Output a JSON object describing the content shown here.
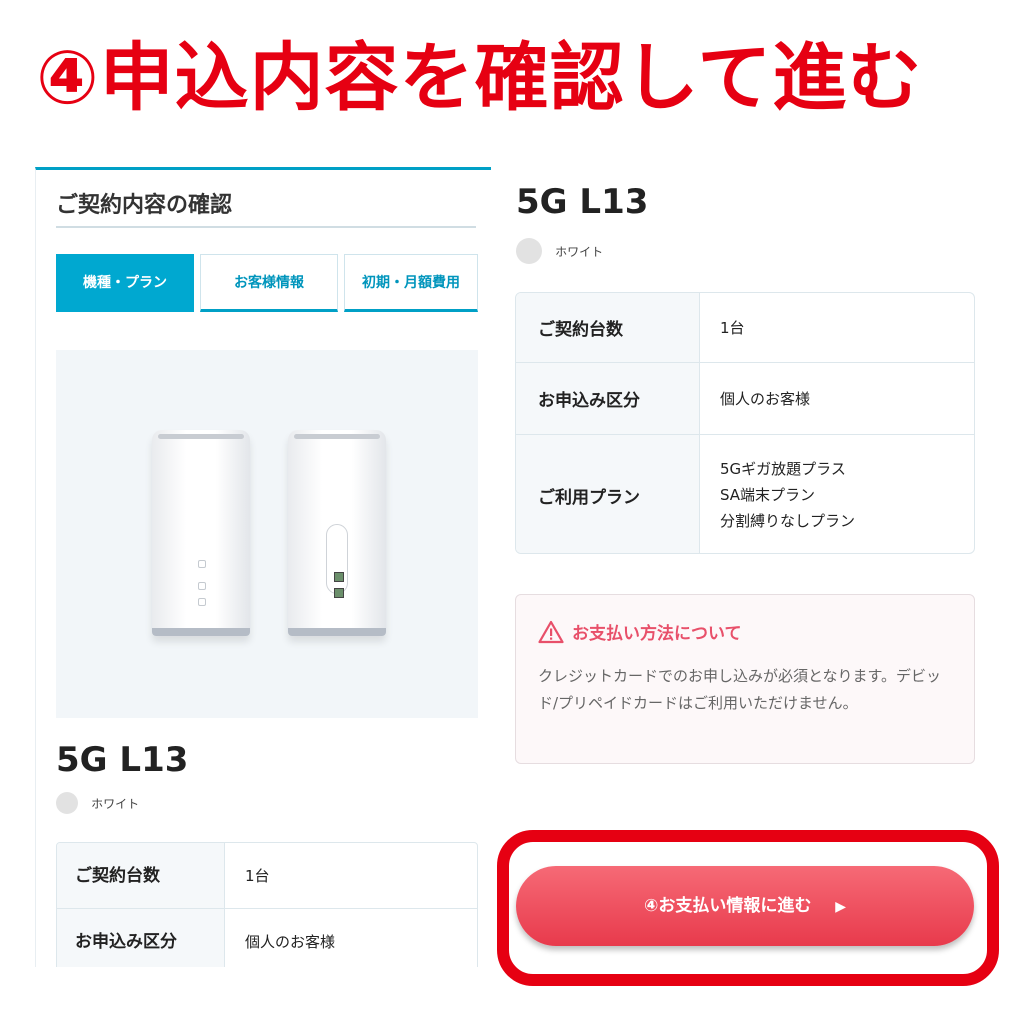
{
  "headline": "④申込内容を確認して進む",
  "panel": {
    "title": "ご契約内容の確認",
    "tabs": [
      {
        "label": "機種・プラン",
        "active": true
      },
      {
        "label": "お客様情報",
        "active": false
      },
      {
        "label": "初期・月額費用",
        "active": false
      }
    ]
  },
  "product": {
    "model": "5G L13",
    "color_label": "ホワイト",
    "color_swatch": "#e2e2e2"
  },
  "contract_table": {
    "rows": [
      {
        "label": "ご契約台数",
        "value": [
          "1台"
        ]
      },
      {
        "label": "お申込み区分",
        "value": [
          "個人のお客様"
        ]
      },
      {
        "label": "ご利用プラン",
        "value": [
          "5Gギガ放題プラス",
          "SA端末プラン",
          "分割縛りなしプラン"
        ]
      }
    ]
  },
  "payment_notice": {
    "title": "お支払い方法について",
    "body": "クレジットカードでのお申し込みが必須となります。デビッド/プリペイドカードはご利用いただけません。",
    "accent": "#e8506a"
  },
  "cta": {
    "label": "④お支払い情報に進む",
    "arrow": "▶",
    "highlight_color": "#e60012"
  }
}
